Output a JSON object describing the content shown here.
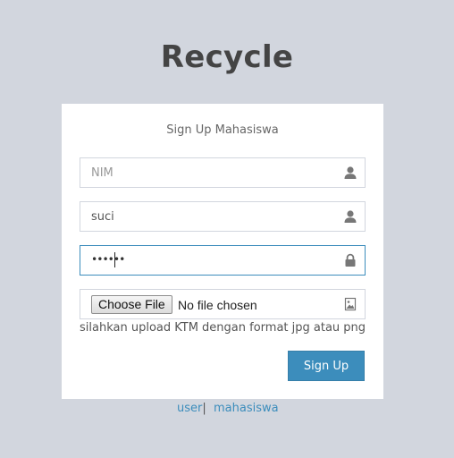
{
  "logo": {
    "title": "Recycle"
  },
  "form": {
    "heading": "Sign Up Mahasiswa",
    "nim": {
      "placeholder": "NIM",
      "value": ""
    },
    "name": {
      "value": "suci"
    },
    "password": {
      "masked_value": "••••••"
    },
    "file": {
      "button_label": "Choose File",
      "status": "No file chosen",
      "hint": "silahkan upload KTM dengan format jpg atau png"
    },
    "submit_label": "Sign Up"
  },
  "footer_links": {
    "user": "user",
    "separator": "|",
    "mahasiswa": "mahasiswa"
  },
  "icons": {
    "nim": "user-icon",
    "name": "user-icon",
    "password": "lock-icon",
    "file": "image-icon"
  },
  "colors": {
    "accent": "#3c8dbc",
    "background": "#d2d6de"
  }
}
